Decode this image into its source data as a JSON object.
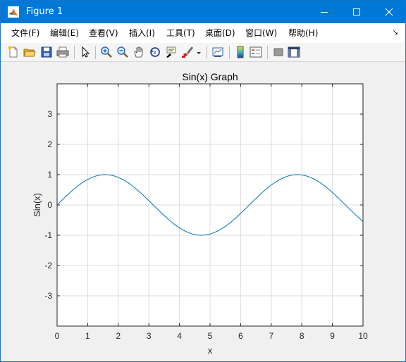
{
  "window": {
    "title": "Figure 1",
    "minimize_label": "",
    "maximize_label": "",
    "close_label": ""
  },
  "menu": {
    "items": [
      {
        "label": "文件(F)"
      },
      {
        "label": "编辑(E)"
      },
      {
        "label": "查看(V)"
      },
      {
        "label": "插入(I)"
      },
      {
        "label": "工具(T)"
      },
      {
        "label": "桌面(D)"
      },
      {
        "label": "窗口(W)"
      },
      {
        "label": "帮助(H)"
      }
    ]
  },
  "toolbar": {
    "icons": [
      "new-figure-icon",
      "open-file-icon",
      "save-icon",
      "print-icon",
      "pointer-icon",
      "zoom-in-icon",
      "zoom-out-icon",
      "pan-hand-icon",
      "rotate-3d-icon",
      "data-cursor-icon",
      "brush-icon",
      "brush-dropdown-icon",
      "link-plot-icon",
      "colorbar-icon",
      "legend-icon",
      "hide-plot-tools-icon",
      "show-plot-tools-icon"
    ]
  },
  "colors": {
    "titlebar": "#0078d7",
    "line": "#0072bd",
    "grid": "#dcdcdc",
    "axes_bg": "#ffffff",
    "figure_bg": "#f0f0f0"
  },
  "chart_data": {
    "type": "line",
    "title": "Sin(x) Graph",
    "xlabel": "x",
    "ylabel": "Sin(x)",
    "xlim": [
      0,
      10
    ],
    "ylim": [
      -4,
      4
    ],
    "xticks": [
      0,
      1,
      2,
      3,
      4,
      5,
      6,
      7,
      8,
      9,
      10
    ],
    "yticks": [
      -3,
      -2,
      -1,
      0,
      1,
      2,
      3
    ],
    "grid": true,
    "function": "sin(x)",
    "series": [
      {
        "x": [
          0,
          0.5,
          1,
          1.5,
          2,
          2.5,
          3,
          3.5,
          4,
          4.5,
          5,
          5.5,
          6,
          6.5,
          7,
          7.5,
          8,
          8.5,
          9,
          9.5,
          10
        ],
        "y": [
          0,
          0.479,
          0.841,
          0.997,
          0.909,
          0.598,
          0.141,
          -0.351,
          -0.757,
          -0.978,
          -0.959,
          -0.706,
          -0.279,
          0.215,
          0.657,
          0.938,
          0.989,
          0.798,
          0.412,
          -0.075,
          -0.544
        ]
      }
    ]
  }
}
